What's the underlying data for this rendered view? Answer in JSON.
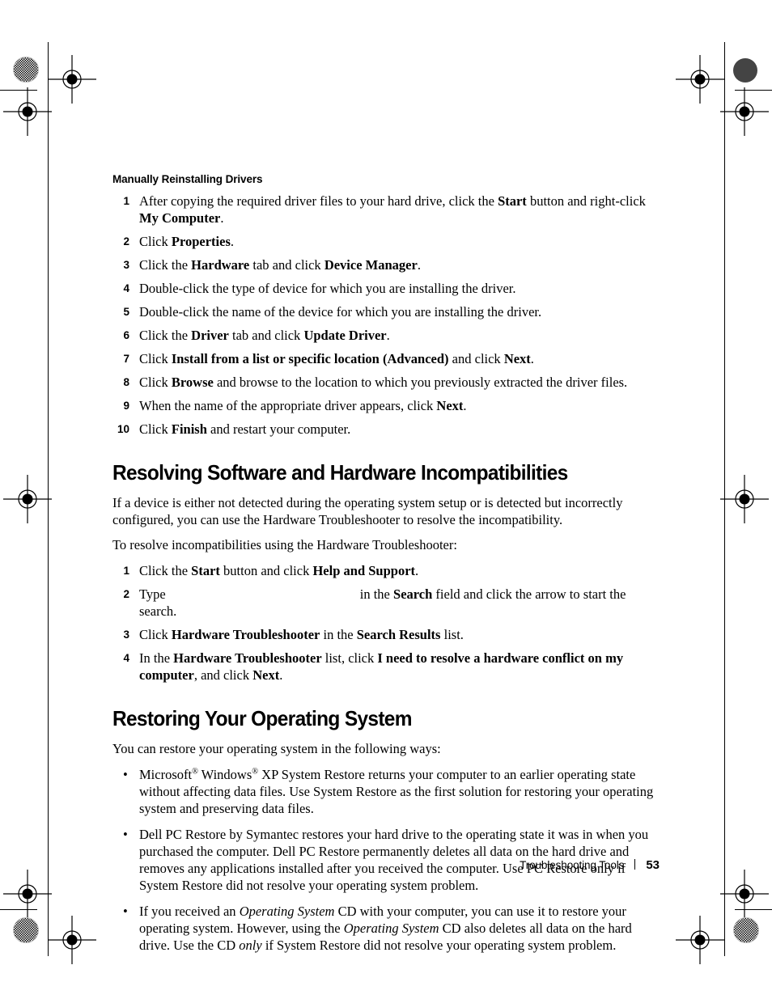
{
  "document": {
    "page_number": "53",
    "footer_label": "Troubleshooting Tools"
  },
  "subsection": {
    "heading": "Manually Reinstalling Drivers",
    "steps": [
      {
        "num": "1",
        "runs": [
          {
            "t": "After copying the required driver files to your hard drive, click the "
          },
          {
            "t": "Start",
            "b": true
          },
          {
            "t": " button and right-click "
          },
          {
            "t": "My Computer",
            "b": true
          },
          {
            "t": "."
          }
        ]
      },
      {
        "num": "2",
        "runs": [
          {
            "t": "Click "
          },
          {
            "t": "Properties",
            "b": true
          },
          {
            "t": "."
          }
        ]
      },
      {
        "num": "3",
        "runs": [
          {
            "t": "Click the "
          },
          {
            "t": "Hardware",
            "b": true
          },
          {
            "t": " tab and click "
          },
          {
            "t": "Device Manager",
            "b": true
          },
          {
            "t": "."
          }
        ]
      },
      {
        "num": "4",
        "runs": [
          {
            "t": "Double-click the type of device for which you are installing the driver."
          }
        ]
      },
      {
        "num": "5",
        "runs": [
          {
            "t": "Double-click the name of the device for which you are installing the driver."
          }
        ]
      },
      {
        "num": "6",
        "runs": [
          {
            "t": "Click the "
          },
          {
            "t": "Driver",
            "b": true
          },
          {
            "t": " tab and click "
          },
          {
            "t": "Update Driver",
            "b": true
          },
          {
            "t": "."
          }
        ]
      },
      {
        "num": "7",
        "runs": [
          {
            "t": "Click "
          },
          {
            "t": "Install from a list or specific location (Advanced)",
            "b": true
          },
          {
            "t": " and click "
          },
          {
            "t": "Next",
            "b": true
          },
          {
            "t": "."
          }
        ]
      },
      {
        "num": "8",
        "runs": [
          {
            "t": "Click "
          },
          {
            "t": "Browse",
            "b": true
          },
          {
            "t": " and browse to the location to which you previously extracted the driver files."
          }
        ]
      },
      {
        "num": "9",
        "runs": [
          {
            "t": "When the name of the appropriate driver appears, click "
          },
          {
            "t": "Next",
            "b": true
          },
          {
            "t": "."
          }
        ]
      },
      {
        "num": "10",
        "runs": [
          {
            "t": "Click "
          },
          {
            "t": "Finish",
            "b": true
          },
          {
            "t": " and restart your computer."
          }
        ]
      }
    ]
  },
  "section_incompatibilities": {
    "title": "Resolving Software and Hardware Incompatibilities",
    "intro_runs": [
      {
        "t": "If a device is either not detected during the operating system setup or is detected but incorrectly configured, you can use the Hardware Troubleshooter to resolve the incompatibility."
      }
    ],
    "lead_in_runs": [
      {
        "t": "To resolve incompatibilities using the Hardware Troubleshooter:"
      }
    ],
    "steps": [
      {
        "num": "1",
        "runs": [
          {
            "t": "Click the "
          },
          {
            "t": "Start",
            "b": true
          },
          {
            "t": " button and click "
          },
          {
            "t": "Help and Support",
            "b": true
          },
          {
            "t": "."
          }
        ]
      },
      {
        "num": "2",
        "runs": [
          {
            "t": "Type"
          },
          {
            "t": "",
            "gap": 240
          },
          {
            "t": "in the "
          },
          {
            "t": "Search",
            "b": true
          },
          {
            "t": " field and click the arrow to start the search."
          }
        ]
      },
      {
        "num": "3",
        "runs": [
          {
            "t": "Click "
          },
          {
            "t": "Hardware Troubleshooter",
            "b": true
          },
          {
            "t": " in the "
          },
          {
            "t": "Search Results",
            "b": true
          },
          {
            "t": " list."
          }
        ]
      },
      {
        "num": "4",
        "runs": [
          {
            "t": "In the "
          },
          {
            "t": "Hardware Troubleshooter",
            "b": true
          },
          {
            "t": " list, click "
          },
          {
            "t": "I need to resolve a hardware conflict on my computer",
            "b": true
          },
          {
            "t": ", and click "
          },
          {
            "t": "Next",
            "b": true
          },
          {
            "t": "."
          }
        ]
      }
    ]
  },
  "section_restoring": {
    "title": "Restoring Your Operating System",
    "intro_runs": [
      {
        "t": "You can restore your operating system in the following ways:"
      }
    ],
    "bullet_char": "•",
    "bullets": [
      {
        "runs": [
          {
            "t": "Microsoft"
          },
          {
            "t": "®",
            "sup": true
          },
          {
            "t": " Windows"
          },
          {
            "t": "®",
            "sup": true
          },
          {
            "t": " XP System Restore returns your computer to an earlier operating state without affecting data files. Use System Restore as the first solution for restoring your operating system and preserving data files."
          }
        ]
      },
      {
        "runs": [
          {
            "t": "Dell PC Restore by Symantec restores your hard drive to the operating state it was in when you purchased the computer. Dell PC Restore permanently deletes all data on the hard drive and removes any applications installed after you received the computer. Use PC Restore only if System Restore did not resolve your operating system problem."
          }
        ]
      },
      {
        "runs": [
          {
            "t": "If you received an "
          },
          {
            "t": "Operating System",
            "i": true
          },
          {
            "t": " CD with your computer, you can use it to restore your operating system. However, using the "
          },
          {
            "t": "Operating System",
            "i": true
          },
          {
            "t": " CD also deletes all data on the hard drive. Use the CD "
          },
          {
            "t": "only",
            "i": true
          },
          {
            "t": " if System Restore did not resolve your operating system problem."
          }
        ]
      }
    ]
  }
}
